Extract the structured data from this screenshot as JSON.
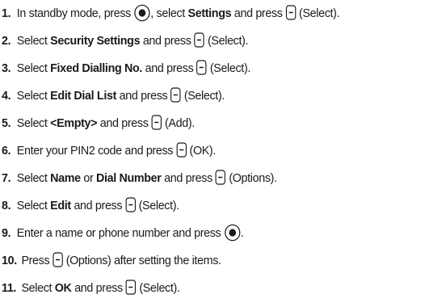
{
  "steps": [
    {
      "num": "1.",
      "parts": [
        {
          "t": "In standby mode, press "
        },
        {
          "icon": "nav-center-key-icon"
        },
        {
          "t": ", select "
        },
        {
          "t": "Settings",
          "b": true
        },
        {
          "t": " and press "
        },
        {
          "icon": "soft-key-icon"
        },
        {
          "t": " (Select)."
        }
      ]
    },
    {
      "num": "2.",
      "parts": [
        {
          "t": "Select "
        },
        {
          "t": "Security Settings",
          "b": true
        },
        {
          "t": " and press "
        },
        {
          "icon": "soft-key-icon"
        },
        {
          "t": " (Select)."
        }
      ]
    },
    {
      "num": "3.",
      "parts": [
        {
          "t": "Select "
        },
        {
          "t": "Fixed Dialling No.",
          "b": true
        },
        {
          "t": " and press "
        },
        {
          "icon": "soft-key-icon"
        },
        {
          "t": " (Select)."
        }
      ]
    },
    {
      "num": "4.",
      "parts": [
        {
          "t": "Select "
        },
        {
          "t": "Edit Dial List",
          "b": true
        },
        {
          "t": " and press "
        },
        {
          "icon": "soft-key-icon"
        },
        {
          "t": " (Select)."
        }
      ]
    },
    {
      "num": "5.",
      "parts": [
        {
          "t": "Select "
        },
        {
          "t": "<Empty>",
          "b": true
        },
        {
          "t": " and press "
        },
        {
          "icon": "soft-key-icon"
        },
        {
          "t": " (Add)."
        }
      ]
    },
    {
      "num": "6.",
      "parts": [
        {
          "t": "Enter your PIN2 code and press "
        },
        {
          "icon": "soft-key-icon"
        },
        {
          "t": " (OK)."
        }
      ]
    },
    {
      "num": "7.",
      "parts": [
        {
          "t": "Select "
        },
        {
          "t": "Name",
          "b": true
        },
        {
          "t": " or "
        },
        {
          "t": "Dial Number",
          "b": true
        },
        {
          "t": " and press "
        },
        {
          "icon": "soft-key-icon"
        },
        {
          "t": " (Options)."
        }
      ]
    },
    {
      "num": "8.",
      "parts": [
        {
          "t": "Select "
        },
        {
          "t": "Edit",
          "b": true
        },
        {
          "t": " and press "
        },
        {
          "icon": "soft-key-icon"
        },
        {
          "t": " (Select)."
        }
      ]
    },
    {
      "num": "9.",
      "parts": [
        {
          "t": "Enter a name or phone number and press "
        },
        {
          "icon": "nav-center-key-icon"
        },
        {
          "t": "."
        }
      ]
    },
    {
      "num": "10.",
      "parts": [
        {
          "t": "Press "
        },
        {
          "icon": "soft-key-icon"
        },
        {
          "t": " (Options) after setting the items."
        }
      ]
    },
    {
      "num": "11.",
      "parts": [
        {
          "t": "Select "
        },
        {
          "t": "OK",
          "b": true
        },
        {
          "t": " and press "
        },
        {
          "icon": "right-soft-key-icon"
        },
        {
          "t": " (Select)."
        }
      ]
    }
  ]
}
